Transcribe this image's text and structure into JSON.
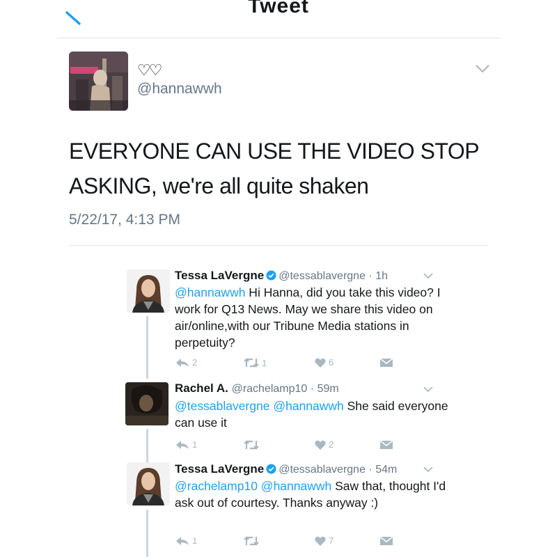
{
  "header": {
    "title": "Tweet"
  },
  "main_tweet": {
    "display_name": "♡♡",
    "handle": "@hannawwh",
    "text": "EVERYONE CAN USE THE VIDEO STOP ASKING, we're all quite shaken",
    "timestamp": "5/22/17, 4:13 PM"
  },
  "replies": [
    {
      "name": "Tessa LaVergne",
      "verified": true,
      "handle": "@tessablavergne",
      "time": "1h",
      "mentions": "@hannawwh",
      "text": " Hi Hanna, did you take this video? I work for Q13 News. May we share this video on air/online,with our Tribune Media stations in perpetuity?",
      "replies": "2",
      "retweets": "1",
      "likes": "6"
    },
    {
      "name": "Rachel A.",
      "verified": false,
      "handle": "@rachelamp10",
      "time": "59m",
      "mentions": "@tessablavergne @hannawwh",
      "text": " She said everyone can use it",
      "replies": "1",
      "retweets": "",
      "likes": "2"
    },
    {
      "name": "Tessa LaVergne",
      "verified": true,
      "handle": "@tessablavergne",
      "time": "54m",
      "mentions": "@rachelamp10 @hannawwh",
      "text": " Saw that, thought I'd ask out of courtesy. Thanks anyway :)",
      "replies": "1",
      "retweets": "",
      "likes": "7"
    }
  ],
  "separator": "·",
  "colors": {
    "link": "#1da1f2",
    "muted": "#657786",
    "icon": "#aab8c2",
    "verified": "#1da1f2"
  }
}
